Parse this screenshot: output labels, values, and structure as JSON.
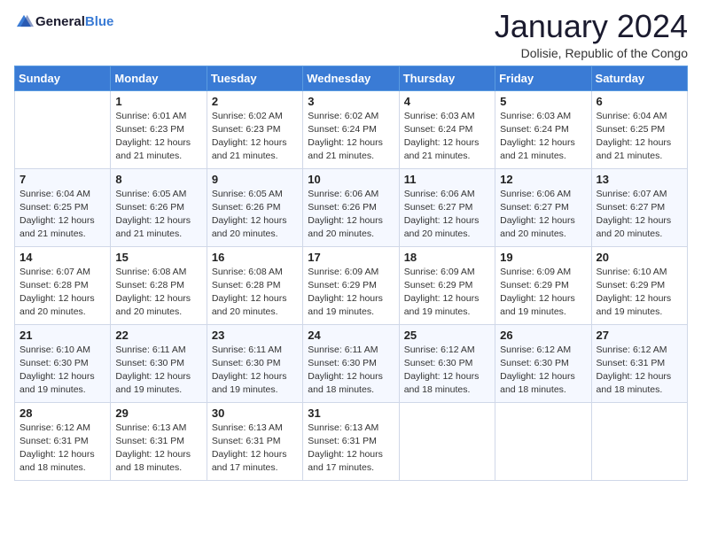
{
  "logo": {
    "line1": "General",
    "line2": "Blue"
  },
  "title": "January 2024",
  "location": "Dolisie, Republic of the Congo",
  "days_of_week": [
    "Sunday",
    "Monday",
    "Tuesday",
    "Wednesday",
    "Thursday",
    "Friday",
    "Saturday"
  ],
  "weeks": [
    [
      {
        "num": "",
        "info": ""
      },
      {
        "num": "1",
        "info": "Sunrise: 6:01 AM\nSunset: 6:23 PM\nDaylight: 12 hours\nand 21 minutes."
      },
      {
        "num": "2",
        "info": "Sunrise: 6:02 AM\nSunset: 6:23 PM\nDaylight: 12 hours\nand 21 minutes."
      },
      {
        "num": "3",
        "info": "Sunrise: 6:02 AM\nSunset: 6:24 PM\nDaylight: 12 hours\nand 21 minutes."
      },
      {
        "num": "4",
        "info": "Sunrise: 6:03 AM\nSunset: 6:24 PM\nDaylight: 12 hours\nand 21 minutes."
      },
      {
        "num": "5",
        "info": "Sunrise: 6:03 AM\nSunset: 6:24 PM\nDaylight: 12 hours\nand 21 minutes."
      },
      {
        "num": "6",
        "info": "Sunrise: 6:04 AM\nSunset: 6:25 PM\nDaylight: 12 hours\nand 21 minutes."
      }
    ],
    [
      {
        "num": "7",
        "info": "Sunrise: 6:04 AM\nSunset: 6:25 PM\nDaylight: 12 hours\nand 21 minutes."
      },
      {
        "num": "8",
        "info": "Sunrise: 6:05 AM\nSunset: 6:26 PM\nDaylight: 12 hours\nand 21 minutes."
      },
      {
        "num": "9",
        "info": "Sunrise: 6:05 AM\nSunset: 6:26 PM\nDaylight: 12 hours\nand 20 minutes."
      },
      {
        "num": "10",
        "info": "Sunrise: 6:06 AM\nSunset: 6:26 PM\nDaylight: 12 hours\nand 20 minutes."
      },
      {
        "num": "11",
        "info": "Sunrise: 6:06 AM\nSunset: 6:27 PM\nDaylight: 12 hours\nand 20 minutes."
      },
      {
        "num": "12",
        "info": "Sunrise: 6:06 AM\nSunset: 6:27 PM\nDaylight: 12 hours\nand 20 minutes."
      },
      {
        "num": "13",
        "info": "Sunrise: 6:07 AM\nSunset: 6:27 PM\nDaylight: 12 hours\nand 20 minutes."
      }
    ],
    [
      {
        "num": "14",
        "info": "Sunrise: 6:07 AM\nSunset: 6:28 PM\nDaylight: 12 hours\nand 20 minutes."
      },
      {
        "num": "15",
        "info": "Sunrise: 6:08 AM\nSunset: 6:28 PM\nDaylight: 12 hours\nand 20 minutes."
      },
      {
        "num": "16",
        "info": "Sunrise: 6:08 AM\nSunset: 6:28 PM\nDaylight: 12 hours\nand 20 minutes."
      },
      {
        "num": "17",
        "info": "Sunrise: 6:09 AM\nSunset: 6:29 PM\nDaylight: 12 hours\nand 19 minutes."
      },
      {
        "num": "18",
        "info": "Sunrise: 6:09 AM\nSunset: 6:29 PM\nDaylight: 12 hours\nand 19 minutes."
      },
      {
        "num": "19",
        "info": "Sunrise: 6:09 AM\nSunset: 6:29 PM\nDaylight: 12 hours\nand 19 minutes."
      },
      {
        "num": "20",
        "info": "Sunrise: 6:10 AM\nSunset: 6:29 PM\nDaylight: 12 hours\nand 19 minutes."
      }
    ],
    [
      {
        "num": "21",
        "info": "Sunrise: 6:10 AM\nSunset: 6:30 PM\nDaylight: 12 hours\nand 19 minutes."
      },
      {
        "num": "22",
        "info": "Sunrise: 6:11 AM\nSunset: 6:30 PM\nDaylight: 12 hours\nand 19 minutes."
      },
      {
        "num": "23",
        "info": "Sunrise: 6:11 AM\nSunset: 6:30 PM\nDaylight: 12 hours\nand 19 minutes."
      },
      {
        "num": "24",
        "info": "Sunrise: 6:11 AM\nSunset: 6:30 PM\nDaylight: 12 hours\nand 18 minutes."
      },
      {
        "num": "25",
        "info": "Sunrise: 6:12 AM\nSunset: 6:30 PM\nDaylight: 12 hours\nand 18 minutes."
      },
      {
        "num": "26",
        "info": "Sunrise: 6:12 AM\nSunset: 6:30 PM\nDaylight: 12 hours\nand 18 minutes."
      },
      {
        "num": "27",
        "info": "Sunrise: 6:12 AM\nSunset: 6:31 PM\nDaylight: 12 hours\nand 18 minutes."
      }
    ],
    [
      {
        "num": "28",
        "info": "Sunrise: 6:12 AM\nSunset: 6:31 PM\nDaylight: 12 hours\nand 18 minutes."
      },
      {
        "num": "29",
        "info": "Sunrise: 6:13 AM\nSunset: 6:31 PM\nDaylight: 12 hours\nand 18 minutes."
      },
      {
        "num": "30",
        "info": "Sunrise: 6:13 AM\nSunset: 6:31 PM\nDaylight: 12 hours\nand 17 minutes."
      },
      {
        "num": "31",
        "info": "Sunrise: 6:13 AM\nSunset: 6:31 PM\nDaylight: 12 hours\nand 17 minutes."
      },
      {
        "num": "",
        "info": ""
      },
      {
        "num": "",
        "info": ""
      },
      {
        "num": "",
        "info": ""
      }
    ]
  ]
}
